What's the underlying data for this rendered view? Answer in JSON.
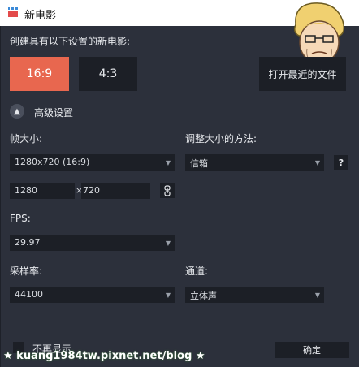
{
  "window": {
    "title": "新电影"
  },
  "header": {
    "create_text": "创建具有以下设置的新电影:"
  },
  "ratio": {
    "option_169": "16:9",
    "option_43": "4:3"
  },
  "open_recent_label": "打开最近的文件",
  "advanced": {
    "label": "高级设置",
    "collapse_icon": "chevron-up-icon"
  },
  "frame_size": {
    "label": "帧大小:",
    "value": "1280x720 (16:9)",
    "width": "1280",
    "height": "720",
    "times": "×"
  },
  "resize": {
    "label": "调整大小的方法:",
    "value": "信箱",
    "help": "?"
  },
  "fps": {
    "label": "FPS:",
    "value": "29.97"
  },
  "sample_rate": {
    "label": "采样率:",
    "value": "44100"
  },
  "channels": {
    "label": "通道:",
    "value": "立体声"
  },
  "footer": {
    "dont_show": "不再显示",
    "ok": "确定"
  },
  "watermark": "★ kuang1984tw.pixnet.net/blog ★",
  "colors": {
    "accent": "#e8674f",
    "panel": "#2c303b",
    "control": "#1c1f26"
  }
}
